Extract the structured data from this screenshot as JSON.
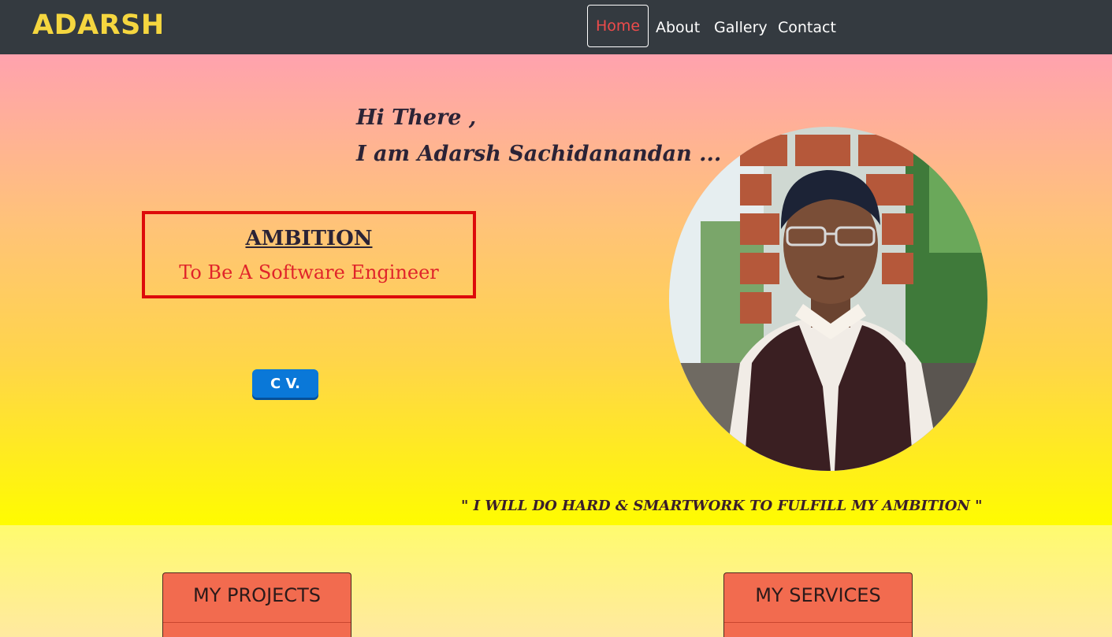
{
  "navbar": {
    "brand": "ADARSH",
    "links": [
      {
        "label": "Home",
        "active": true
      },
      {
        "label": "About"
      },
      {
        "label": "Gallery"
      },
      {
        "label": "Contact"
      }
    ]
  },
  "hero": {
    "greeting_line1": "Hi There ,",
    "greeting_line2": "I am Adarsh Sachidanandan ...",
    "ambition_title": "AMBITION",
    "ambition_text": "To Be A Software Engineer",
    "cv_button": "C V.",
    "quote": "\" I WILL DO HARD & SMARTWORK TO FULFILL MY AMBITION \""
  },
  "sections": {
    "projects_title": "MY PROJECTS",
    "services_title": "MY SERVICES"
  },
  "colors": {
    "navbar": "#343a40",
    "brand": "#f5d63f",
    "active_link": "#ee4b4b",
    "ambition_border": "#dd0b0b",
    "cv_button": "#0a78d8",
    "card_header": "#f26b4f"
  }
}
